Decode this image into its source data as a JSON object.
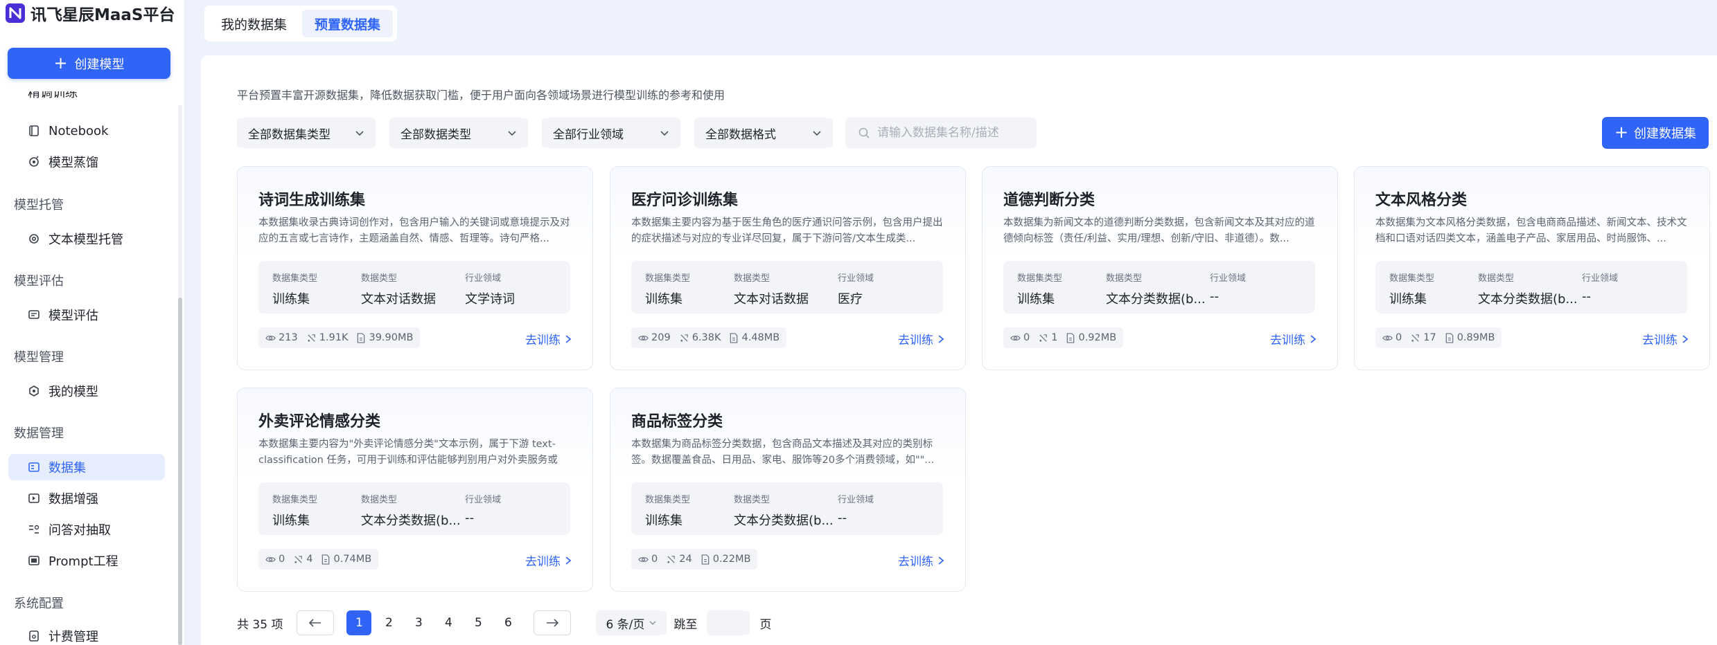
{
  "sidebar": {
    "logo_text": "讯飞星辰MaaS平台",
    "create_model_label": "创建模型",
    "cut_item_label": "精调训练",
    "items": [
      {
        "label": "Notebook",
        "icon": "notebook-icon"
      },
      {
        "label": "模型蒸馏",
        "icon": "distill-icon"
      }
    ],
    "groups": [
      {
        "title": "模型托管",
        "items": [
          {
            "label": "文本模型托管",
            "icon": "hosting-icon"
          }
        ]
      },
      {
        "title": "模型评估",
        "items": [
          {
            "label": "模型评估",
            "icon": "evaluate-icon"
          }
        ]
      },
      {
        "title": "模型管理",
        "items": [
          {
            "label": "我的模型",
            "icon": "model-icon"
          }
        ]
      },
      {
        "title": "数据管理",
        "items": [
          {
            "label": "数据集",
            "icon": "dataset-icon",
            "active": true
          },
          {
            "label": "数据增强",
            "icon": "augment-icon"
          },
          {
            "label": "问答对抽取",
            "icon": "qa-extract-icon"
          },
          {
            "label": "Prompt工程",
            "icon": "prompt-icon"
          }
        ]
      },
      {
        "title": "系统配置",
        "items": [
          {
            "label": "计费管理",
            "icon": "billing-icon"
          }
        ]
      }
    ]
  },
  "tabs": [
    {
      "label": "我的数据集",
      "active": false
    },
    {
      "label": "预置数据集",
      "active": true
    }
  ],
  "main": {
    "description": "平台预置丰富开源数据集，降低数据获取门槛，便于用户面向各领域场景进行模型训练的参考和使用",
    "filters": [
      "全部数据集类型",
      "全部数据类型",
      "全部行业领域",
      "全部数据格式"
    ],
    "search_placeholder": "请输入数据集名称/描述",
    "create_dataset_label": "创建数据集",
    "meta_labels": {
      "dataset_type": "数据集类型",
      "data_type": "数据类型",
      "industry": "行业领域"
    },
    "train_label": "去训练",
    "cards": [
      {
        "title": "诗词生成训练集",
        "desc": "本数据集收录古典诗词创作对，包含用户输入的关键词或意境提示及对应的五言或七言诗作，主题涵盖自然、情感、哲理等。诗句严格...",
        "dataset_type": "训练集",
        "data_type": "文本对话数据",
        "industry": "文学诗词",
        "views": "213",
        "trainings": "1.91K",
        "size": "39.90MB"
      },
      {
        "title": "医疗问诊训练集",
        "desc": "本数据集主要内容为基于医生角色的医疗通识问答示例，包含用户提出的症状描述与对应的专业详尽回复，属于下游问答/文本生成类...",
        "dataset_type": "训练集",
        "data_type": "文本对话数据",
        "industry": "医疗",
        "views": "209",
        "trainings": "6.38K",
        "size": "4.48MB"
      },
      {
        "title": "道德判断分类",
        "desc": "本数据集为新闻文本的道德判断分类数据，包含新闻文本及其对应的道德倾向标签（责任/利益、实用/理想、创新/守旧、非道德）。数...",
        "dataset_type": "训练集",
        "data_type": "文本分类数据(b...",
        "industry": "--",
        "views": "0",
        "trainings": "1",
        "size": "0.92MB"
      },
      {
        "title": "文本风格分类",
        "desc": "本数据集为文本风格分类数据，包含电商商品描述、新闻文本、技术文档和口语对话四类文本，涵盖电子产品、家居用品、时尚服饰、...",
        "dataset_type": "训练集",
        "data_type": "文本分类数据(b...",
        "industry": "--",
        "views": "0",
        "trainings": "17",
        "size": "0.89MB"
      },
      {
        "title": "外卖评论情感分类",
        "desc": "本数据集主要内容为\"外卖评论情感分类\"文本示例，属于下游 text-classification 任务，可用于训练和评估能够判别用户对外卖服务或餐...",
        "dataset_type": "训练集",
        "data_type": "文本分类数据(b...",
        "industry": "--",
        "views": "0",
        "trainings": "4",
        "size": "0.74MB"
      },
      {
        "title": "商品标签分类",
        "desc": "本数据集为商品标签分类数据，包含商品文本描述及其对应的类别标签。数据覆盖食品、日用品、家电、服饰等20多个消费领域，如\"\"...",
        "dataset_type": "训练集",
        "data_type": "文本分类数据(b...",
        "industry": "--",
        "views": "0",
        "trainings": "24",
        "size": "0.22MB"
      }
    ]
  },
  "pagination": {
    "total_text": "共 35 项",
    "pages": [
      "1",
      "2",
      "3",
      "4",
      "5",
      "6"
    ],
    "current": "1",
    "page_size": "6 条/页",
    "jump_label": "跳至",
    "page_suffix": "页"
  },
  "colors": {
    "primary": "#2f64f6",
    "logo": "#4a2fd6",
    "active_bg": "#e6edfe",
    "page_bg": "#eef2fd"
  }
}
